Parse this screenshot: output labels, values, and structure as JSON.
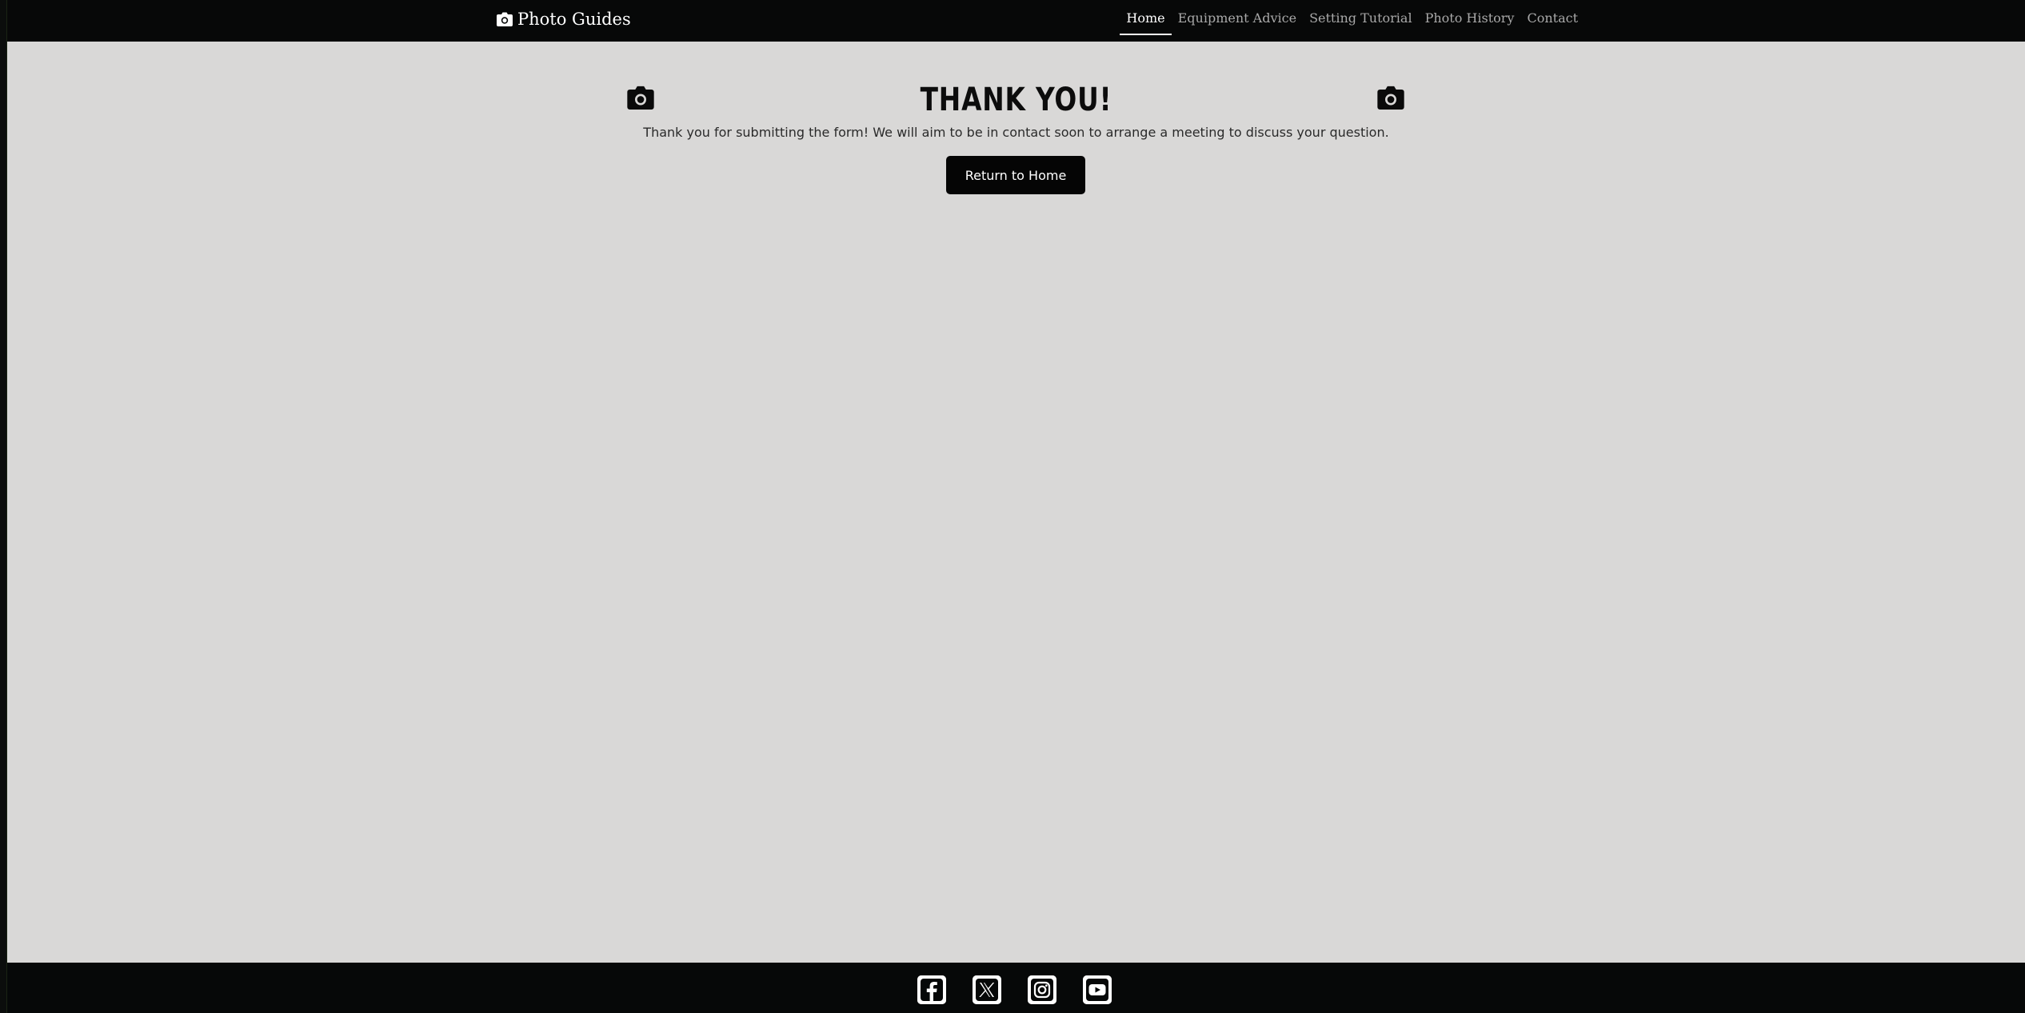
{
  "navbar": {
    "brand": "Photo Guides",
    "brand_icon": "camera-icon",
    "links": [
      {
        "label": "Home",
        "active": true
      },
      {
        "label": "Equipment Advice",
        "active": false
      },
      {
        "label": "Setting Tutorial",
        "active": false
      },
      {
        "label": "Photo History",
        "active": false
      },
      {
        "label": "Contact",
        "active": false
      }
    ]
  },
  "main": {
    "title": "THANK YOU!",
    "message": "Thank you for submitting the form! We will aim to be in contact soon to arrange a meeting to discuss your question.",
    "button_label": "Return to Home",
    "decor_icons": [
      "camera-icon",
      "camera-icon"
    ]
  },
  "footer": {
    "socials": [
      "facebook-icon",
      "x-twitter-icon",
      "instagram-icon",
      "youtube-icon"
    ]
  },
  "colors": {
    "nav_bg": "#070808",
    "page_bg": "#d9d8d7",
    "button_bg": "#050505",
    "nav_inactive": "#a9a9a9",
    "nav_active": "#ffffff"
  }
}
